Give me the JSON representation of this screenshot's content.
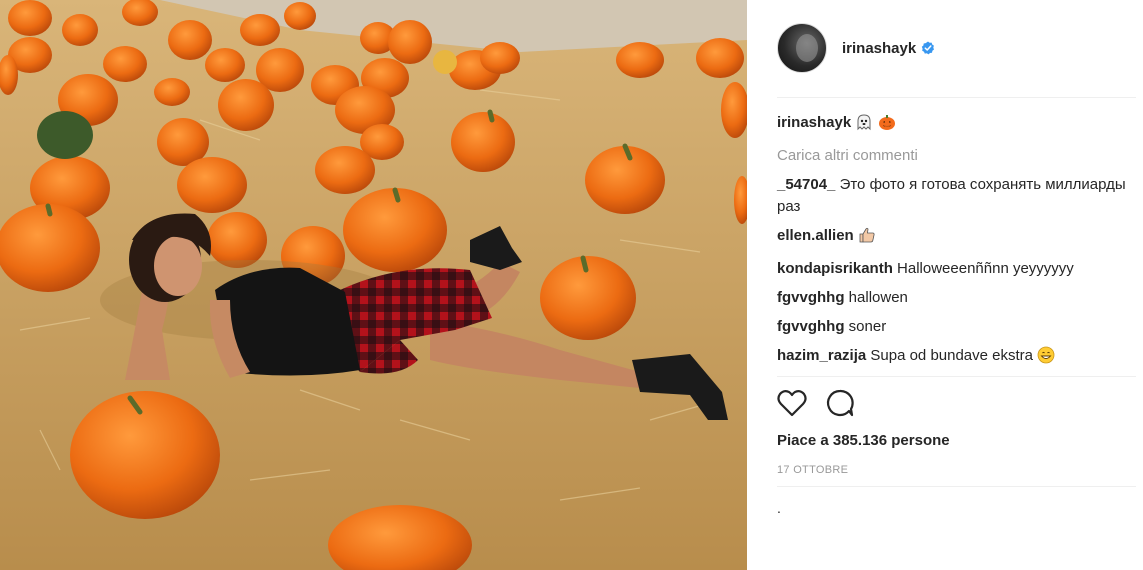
{
  "post": {
    "username": "irinashayk",
    "verified": true,
    "photo_alt": "post-photo"
  },
  "caption": {
    "user": "irinashayk",
    "emojis": [
      "ghost-emoji",
      "jack-o-lantern-emoji"
    ]
  },
  "load_more_label": "Carica altri commenti",
  "comments": [
    {
      "user": "_54704_",
      "text": "Это фото я готова сохранять миллиарды раз"
    },
    {
      "user": "ellen.allien",
      "text": "",
      "emoji": "thumbs-up-emoji"
    },
    {
      "user": "kondapisrikanth",
      "text": "Halloweeenññnn yeyyyyyy"
    },
    {
      "user": "fgvvghhg",
      "text": "hallowen"
    },
    {
      "user": "fgvvghhg",
      "text": "soner"
    },
    {
      "user": "hazim_razija",
      "text": "Supa od bundave ekstra",
      "emoji": "grinning-emoji"
    }
  ],
  "actions": {
    "like_icon": "heart-icon",
    "comment_icon": "comment-icon"
  },
  "likes_text": "Piace a 385.136 persone",
  "date_text": "17 OTTOBRE",
  "add_comment_text": ".",
  "colors": {
    "verified_blue": "#3897f0",
    "muted_text": "#999999",
    "primary_text": "#262626",
    "divider": "#efefef"
  }
}
